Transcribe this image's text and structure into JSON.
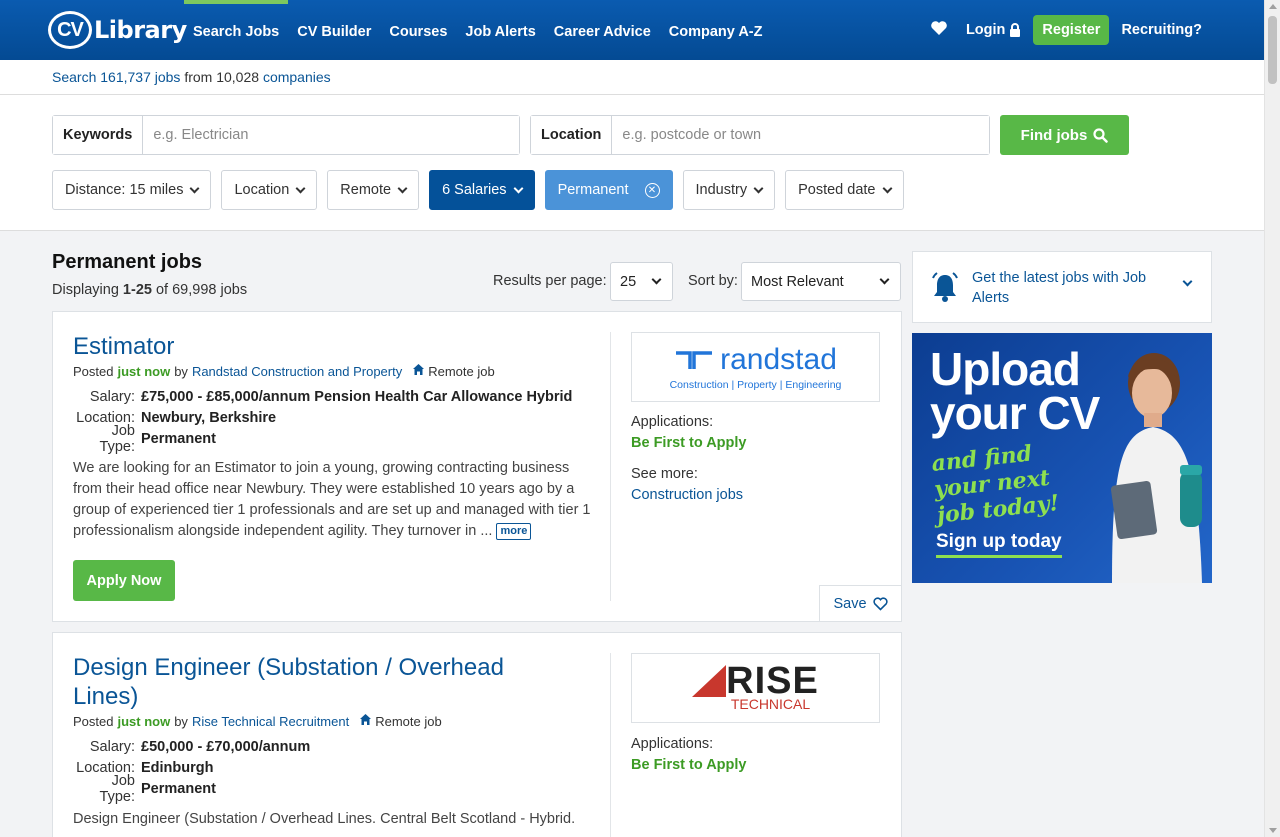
{
  "header": {
    "logo_text": "CV Library",
    "logo_initials": "CV",
    "logo_word": "Library",
    "nav": [
      "Search Jobs",
      "CV Builder",
      "Courses",
      "Job Alerts",
      "Career Advice",
      "Company A-Z"
    ],
    "login": "Login",
    "register": "Register",
    "recruiting": "Recruiting?"
  },
  "countbar": {
    "prefix": "Search ",
    "jobs_count": "161,737 jobs",
    "middle": " from 10,028 ",
    "companies": "companies"
  },
  "search": {
    "keywords_label": "Keywords",
    "keywords_placeholder": "e.g. Electrician",
    "location_label": "Location",
    "location_placeholder": "e.g. postcode or town",
    "find_button": "Find jobs"
  },
  "filters": {
    "distance": "Distance: 15 miles",
    "location": "Location",
    "remote": "Remote",
    "salaries": "6 Salaries",
    "permanent": "Permanent",
    "industry": "Industry",
    "posted_date": "Posted date"
  },
  "results": {
    "title": "Permanent jobs",
    "displaying_prefix": "Displaying ",
    "range": "1-25",
    "displaying_suffix": " of 69,998 jobs",
    "per_page_label": "Results per page:",
    "per_page_value": "25",
    "sort_label": "Sort by:",
    "sort_value": "Most Relevant"
  },
  "jobs": [
    {
      "title": "Estimator",
      "posted_prefix": "Posted",
      "posted_when": "just now",
      "by": "by",
      "company": "Randstad Construction and Property",
      "remote": "Remote job",
      "salary_label": "Salary:",
      "salary": "£75,000 - £85,000/annum Pension Health Car Allowance Hybrid",
      "location_label": "Location:",
      "location": "Newbury, Berkshire",
      "type_label": "Job Type:",
      "type": "Permanent",
      "description": "We are looking for an Estimator to join a young, growing contracting business from their head office near Newbury. They were established 10 years ago by a group of experienced tier 1 professionals and are set up and managed with tier 1 professionalism alongside independent agility. They turnover in ...",
      "more": "more",
      "apply": "Apply Now",
      "logo_name": "randstad",
      "logo_sub": "Construction | Property | Engineering",
      "applications_label": "Applications:",
      "applications_value": "Be First to Apply",
      "see_more_label": "See more:",
      "see_more_link": "Construction jobs",
      "save": "Save"
    },
    {
      "title": "Design Engineer (Substation / Overhead Lines)",
      "posted_prefix": "Posted",
      "posted_when": "just now",
      "by": "by",
      "company": "Rise Technical Recruitment",
      "remote": "Remote job",
      "salary_label": "Salary:",
      "salary": "£50,000 - £70,000/annum",
      "location_label": "Location:",
      "location": "Edinburgh",
      "type_label": "Job Type:",
      "type": "Permanent",
      "description": "Design Engineer (Substation / Overhead Lines. Central Belt Scotland - Hybrid.",
      "logo_name": "RISE",
      "logo_sub": "TECHNICAL",
      "applications_label": "Applications:",
      "applications_value": "Be First to Apply"
    }
  ],
  "sidebar": {
    "alerts_text": "Get the latest jobs with Job Alerts",
    "banner_line1": "Upload",
    "banner_line2": "your CV",
    "banner_script": "and find your next job today!",
    "banner_cta": "Sign up today"
  },
  "colors": {
    "brand_blue": "#044a93",
    "link_blue": "#0a5596",
    "green": "#58b847",
    "chip_selected": "#045199",
    "chip_permanent": "#4b93d8"
  }
}
